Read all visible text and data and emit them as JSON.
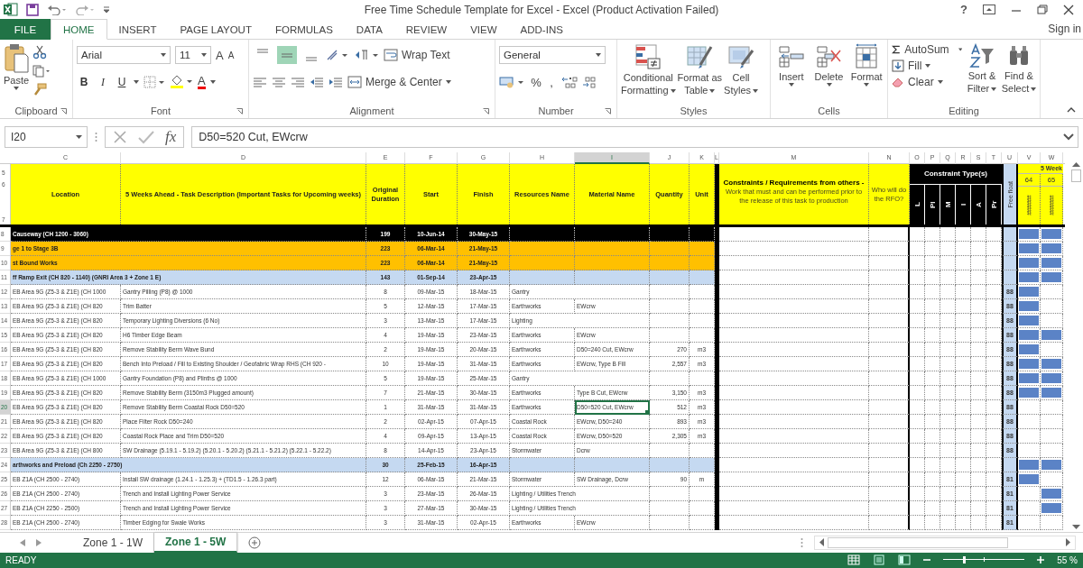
{
  "title_bar": {
    "title": "Free Time Schedule Template for Excel - Excel (Product Activation Failed)",
    "help": "?"
  },
  "tabs": [
    {
      "label": "FILE",
      "kind": "file",
      "selected": false
    },
    {
      "label": "HOME",
      "kind": "tab",
      "selected": true
    },
    {
      "label": "INSERT",
      "kind": "tab",
      "selected": false
    },
    {
      "label": "PAGE LAYOUT",
      "kind": "tab",
      "selected": false
    },
    {
      "label": "FORMULAS",
      "kind": "tab",
      "selected": false
    },
    {
      "label": "DATA",
      "kind": "tab",
      "selected": false
    },
    {
      "label": "REVIEW",
      "kind": "tab",
      "selected": false
    },
    {
      "label": "VIEW",
      "kind": "tab",
      "selected": false
    },
    {
      "label": "ADD-INS",
      "kind": "tab",
      "selected": false
    }
  ],
  "sign_in": "Sign in",
  "ribbon": {
    "clipboard": {
      "paste": "Paste",
      "label": "Clipboard"
    },
    "font": {
      "name": "Arial",
      "size": "11",
      "grow": "A",
      "shrink": "A",
      "styles": [
        {
          "text": "B",
          "kind": "bold"
        },
        {
          "text": "I",
          "kind": "italic"
        },
        {
          "text": "U",
          "kind": "underline"
        }
      ],
      "color_button": "A",
      "label": "Font"
    },
    "alignment": {
      "vertical": [
        {
          "kind": "top",
          "selected": false
        },
        {
          "kind": "middle",
          "selected": true
        },
        {
          "kind": "bottom",
          "selected": false
        }
      ],
      "wrap_text": "Wrap Text",
      "merge": "Merge & Center",
      "label": "Alignment"
    },
    "number": {
      "format": "General",
      "percent": "%",
      "comma": ",",
      "label": "Number"
    },
    "styles": {
      "buttons": [
        {
          "kind": "conditional",
          "lines": [
            "Conditional",
            "Formatting"
          ]
        },
        {
          "kind": "table",
          "lines": [
            "Format as",
            "Table"
          ]
        },
        {
          "kind": "cell",
          "lines": [
            "Cell",
            "Styles"
          ]
        }
      ],
      "label": "Styles"
    },
    "cells": {
      "buttons": [
        {
          "kind": "insert",
          "label": "Insert"
        },
        {
          "kind": "delete",
          "label": "Delete"
        },
        {
          "kind": "format",
          "label": "Format"
        }
      ],
      "label": "Cells"
    },
    "editing": {
      "autosum": "AutoSum",
      "fill": "Fill",
      "clear": "Clear",
      "sort": [
        "Sort &",
        "Filter"
      ],
      "find": [
        "Find &",
        "Select"
      ],
      "label": "Editing"
    }
  },
  "formula_bar": {
    "name_box": "I20",
    "fx": "fx",
    "value": "D50=520 Cut, EWcrw"
  },
  "columns": [
    {
      "letter": "C",
      "selected": false
    },
    {
      "letter": "D",
      "selected": false
    },
    {
      "letter": "E",
      "selected": false
    },
    {
      "letter": "F",
      "selected": false
    },
    {
      "letter": "G",
      "selected": false
    },
    {
      "letter": "H",
      "selected": false
    },
    {
      "letter": "I",
      "selected": true
    },
    {
      "letter": "J",
      "selected": false
    },
    {
      "letter": "K",
      "selected": false
    },
    {
      "letter": "L",
      "selected": false
    },
    {
      "letter": "M",
      "selected": false
    },
    {
      "letter": "N",
      "selected": false
    },
    {
      "letter": "O",
      "selected": false
    },
    {
      "letter": "P",
      "selected": false
    },
    {
      "letter": "Q",
      "selected": false
    },
    {
      "letter": "R",
      "selected": false
    },
    {
      "letter": "S",
      "selected": false
    },
    {
      "letter": "T",
      "selected": false
    },
    {
      "letter": "U",
      "selected": false
    },
    {
      "letter": "V",
      "selected": false
    },
    {
      "letter": "W",
      "selected": false
    }
  ],
  "header": {
    "rows": [
      "5",
      "6",
      "7"
    ],
    "location": "Location",
    "task": "5 Weeks Ahead - Task Description (Important Tasks for Upcoming weeks)",
    "duration": "Original Duration",
    "start": "Start",
    "finish": "Finish",
    "resource": "Resources Name",
    "material": "Material Name",
    "quantity": "Quantity",
    "unit": "Unit",
    "constraints": "**Constraints / Requirements from others -** Work that must and can be performed prior to the release of this task to production",
    "rfo": "Who will do the RFO?",
    "constraint_types": "Constraint Type(s)",
    "constraint_codes": [
      "L",
      "Pl",
      "M",
      "I",
      "A",
      "Pr"
    ],
    "free_float": "Free float",
    "weeks": "5 Week",
    "week_numbers": [
      "64",
      "65"
    ],
    "week_dates": [
      "#######",
      "#######"
    ]
  },
  "rows": [
    {
      "num": "8",
      "kind": "black",
      "location": "Causeway (CH 1200 - 3060)",
      "duration": "199",
      "start": "10-Jun-14",
      "finish": "30-May-15",
      "bars": [
        true,
        true
      ],
      "selected": false
    },
    {
      "num": "9",
      "kind": "orange",
      "location": "ge 1 to Stage 3B",
      "duration": "223",
      "start": "06-Mar-14",
      "finish": "21-May-15",
      "bars": [
        true,
        true
      ],
      "selected": false
    },
    {
      "num": "10",
      "kind": "orange",
      "location": "st Bound Works",
      "duration": "223",
      "start": "06-Mar-14",
      "finish": "21-May-15",
      "bars": [
        true,
        true
      ],
      "selected": false
    },
    {
      "num": "11",
      "kind": "blue",
      "location": "ff Ramp Exit (CH 820 - 1140) (GNRI Area 3 + Zone 1 E)",
      "duration": "143",
      "start": "01-Sep-14",
      "finish": "23-Apr-15",
      "bars": [
        true,
        true
      ],
      "selected": false
    },
    {
      "num": "12",
      "kind": "task",
      "location": "EB Area 9G (Z5-3 & Z1E) (CH 1000",
      "task": "Gantry Pilling (P8) @ 1000",
      "duration": "8",
      "start": "09-Mar-15",
      "finish": "18-Mar-15",
      "resource": "Gantry",
      "free_float": "88",
      "bars": [
        true,
        false
      ],
      "selected": false
    },
    {
      "num": "13",
      "kind": "task",
      "location": "EB Area 9G (Z5-3 & Z1E) (CH 820",
      "task": "Trim Batter",
      "duration": "5",
      "start": "12-Mar-15",
      "finish": "17-Mar-15",
      "resource": "Earthworks",
      "material": "EWcrw",
      "free_float": "88",
      "bars": [
        true,
        false
      ],
      "selected": false
    },
    {
      "num": "14",
      "kind": "task",
      "location": "EB Area 9G (Z5-3 & Z1E) (CH 820",
      "task": "Temporary Lighting Diversions (6 No)",
      "duration": "3",
      "start": "13-Mar-15",
      "finish": "17-Mar-15",
      "resource": "Lighting",
      "free_float": "88",
      "bars": [
        true,
        false
      ],
      "selected": false
    },
    {
      "num": "15",
      "kind": "task",
      "location": "EB Area 9G (Z5-3 & Z1E) (CH 820",
      "task": "H6 Timber Edge Beam",
      "duration": "4",
      "start": "19-Mar-15",
      "finish": "23-Mar-15",
      "resource": "Earthworks",
      "material": "EWcrw",
      "free_float": "88",
      "bars": [
        true,
        true
      ],
      "selected": false
    },
    {
      "num": "16",
      "kind": "task",
      "location": "EB Area 9G (Z5-3 & Z1E) (CH 820",
      "task": "Remove Stability Berm Wave Bund",
      "duration": "2",
      "start": "19-Mar-15",
      "finish": "20-Mar-15",
      "resource": "Earthworks",
      "material": "D50=240 Cut, EWcrw",
      "quantity": "270",
      "unit": "m3",
      "free_float": "88",
      "bars": [
        true,
        false
      ],
      "selected": false
    },
    {
      "num": "17",
      "kind": "task",
      "location": "EB Area 9G (Z5-3 & Z1E) (CH 820",
      "task": "Bench Into Preload / Fill to Existing Shoulder / Geofabric Wrap RHS (CH 920 -",
      "duration": "10",
      "start": "19-Mar-15",
      "finish": "31-Mar-15",
      "resource": "Earthworks",
      "material": "EWcrw, Type B Fill",
      "quantity": "2,557",
      "unit": "m3",
      "free_float": "88",
      "bars": [
        true,
        true
      ],
      "selected": false
    },
    {
      "num": "18",
      "kind": "task",
      "location": "EB Area 9G (Z5-3 & Z1E) (CH 1000",
      "task": "Gantry Foundation (P8) and Plinths @ 1000",
      "duration": "5",
      "start": "19-Mar-15",
      "finish": "25-Mar-15",
      "resource": "Gantry",
      "free_float": "88",
      "bars": [
        true,
        true
      ],
      "selected": false
    },
    {
      "num": "19",
      "kind": "task",
      "location": "EB Area 9G (Z5-3 & Z1E) (CH 820",
      "task": "Remove Stability Berm (3150m3 Plugged amount)",
      "duration": "7",
      "start": "21-Mar-15",
      "finish": "30-Mar-15",
      "resource": "Earthworks",
      "material": "Type B Cut, EWcrw",
      "quantity": "3,150",
      "unit": "m3",
      "free_float": "88",
      "bars": [
        true,
        true
      ],
      "selected": false
    },
    {
      "num": "20",
      "kind": "task",
      "location": "EB Area 9G (Z5-3 & Z1E) (CH 820",
      "task": "Remove Stability Berm Coastal Rock D50=520",
      "duration": "1",
      "start": "31-Mar-15",
      "finish": "31-Mar-15",
      "resource": "Earthworks",
      "material": "D50=520 Cut, EWcrw",
      "quantity": "512",
      "unit": "m3",
      "free_float": "88",
      "bars": [
        false,
        false
      ],
      "selected": true
    },
    {
      "num": "21",
      "kind": "task",
      "location": "EB Area 9G (Z5-3 & Z1E) (CH 820",
      "task": "Place Filter Rock D50=240",
      "duration": "2",
      "start": "02-Apr-15",
      "finish": "07-Apr-15",
      "resource": "Coastal Rock",
      "material": "EWcrw, D50=240",
      "quantity": "893",
      "unit": "m3",
      "free_float": "88",
      "bars": [
        false,
        false
      ],
      "selected": false
    },
    {
      "num": "22",
      "kind": "task",
      "location": "EB Area 9G (Z5-3 & Z1E) (CH 820",
      "task": "Coastal Rock Place and Trim D50=520",
      "duration": "4",
      "start": "09-Apr-15",
      "finish": "13-Apr-15",
      "resource": "Coastal Rock",
      "material": "EWcrw, D50=520",
      "quantity": "2,305",
      "unit": "m3",
      "free_float": "88",
      "bars": [
        false,
        false
      ],
      "selected": false
    },
    {
      "num": "23",
      "kind": "task",
      "location": "EB Area 9G (Z5-3 & Z1E) (CH 800",
      "task": "SW Drainage (5.19.1 - 5.19.2) (5.20.1 - 5.20.2) (5.21.1 - 5.21.2) (5.22.1 - 5.22.2)",
      "duration": "8",
      "start": "14-Apr-15",
      "finish": "23-Apr-15",
      "resource": "Stormwater",
      "material": "Dcrw",
      "free_float": "88",
      "bars": [
        false,
        false
      ],
      "selected": false
    },
    {
      "num": "24",
      "kind": "blue",
      "location": "arthworks and Preload (Ch 2250 - 2750)",
      "duration": "30",
      "start": "25-Feb-15",
      "finish": "16-Apr-15",
      "bars": [
        true,
        true
      ],
      "selected": false
    },
    {
      "num": "25",
      "kind": "task",
      "location": "EB Z1A (CH 2500 - 2740)",
      "task": "Install SW drainage (1.24.1 - 1.25.3) + (TD1.5 - 1.26.3 part)",
      "duration": "12",
      "start": "06-Mar-15",
      "finish": "21-Mar-15",
      "resource": "Stormwater",
      "material": "SW Drainage, Dcrw",
      "quantity": "90",
      "unit": "m",
      "free_float": "81",
      "bars": [
        true,
        false
      ],
      "selected": false
    },
    {
      "num": "26",
      "kind": "task",
      "location": "EB Z1A (CH 2500 - 2740)",
      "task": "Trench and Install Lighting Power Service",
      "duration": "3",
      "start": "23-Mar-15",
      "finish": "26-Mar-15",
      "resource": "Lighting / Utilities Trench",
      "free_float": "81",
      "bars": [
        false,
        true
      ],
      "selected": false
    },
    {
      "num": "27",
      "kind": "task",
      "location": "EB Z1A (CH 2250 - 2500)",
      "task": "Trench and Install Lighting Power Service",
      "duration": "3",
      "start": "27-Mar-15",
      "finish": "30-Mar-15",
      "resource": "Lighting / Utilities Trench",
      "free_float": "81",
      "bars": [
        false,
        true
      ],
      "selected": false
    },
    {
      "num": "28",
      "kind": "task",
      "location": "EB Z1A (CH 2500 - 2740)",
      "task": "Timber Edging for Swale Works",
      "duration": "3",
      "start": "31-Mar-15",
      "finish": "02-Apr-15",
      "resource": "Earthworks",
      "material": "EWcrw",
      "free_float": "81",
      "bars": [
        false,
        false
      ],
      "selected": false
    }
  ],
  "sheets": [
    {
      "label": "Zone 1 - 1W",
      "selected": false
    },
    {
      "label": "Zone 1 - 5W",
      "selected": true
    }
  ],
  "status": {
    "text": "READY",
    "zoom": "55 %",
    "level": 0.25
  }
}
